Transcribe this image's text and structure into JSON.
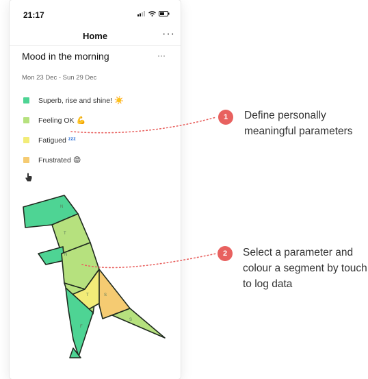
{
  "status_bar": {
    "time": "21:17"
  },
  "navbar": {
    "title": "Home",
    "more": "···"
  },
  "card": {
    "title": "Mood in the morning",
    "more": "···",
    "date_range": "Mon 23 Dec - Sun 29 Dec"
  },
  "parameters": [
    {
      "label": "Superb, rise and shine!",
      "emoji": "☀️",
      "color": "#4ed494"
    },
    {
      "label": "Feeling OK",
      "emoji": "💪",
      "color": "#b6e17e"
    },
    {
      "label": "Fatigued",
      "emoji": "ᶻᶻᶻ",
      "color": "#f2ec78"
    },
    {
      "label": "Frustrated",
      "emoji": "😡",
      "color": "#f5cb72"
    }
  ],
  "segment_letters": [
    "N",
    "T",
    "N",
    "T",
    "S",
    "F",
    "S"
  ],
  "callouts": [
    {
      "number": "1",
      "text": "Define personally meaningful parameters"
    },
    {
      "number": "2",
      "text": "Select a parameter and colour a segment by touch to log data"
    }
  ],
  "colors": {
    "accent": "#e8615f",
    "green": "#4ed494",
    "light_green": "#b6e17e",
    "yellow": "#f2ec78",
    "orange": "#f5cb72",
    "outline": "#1f2a1f"
  }
}
